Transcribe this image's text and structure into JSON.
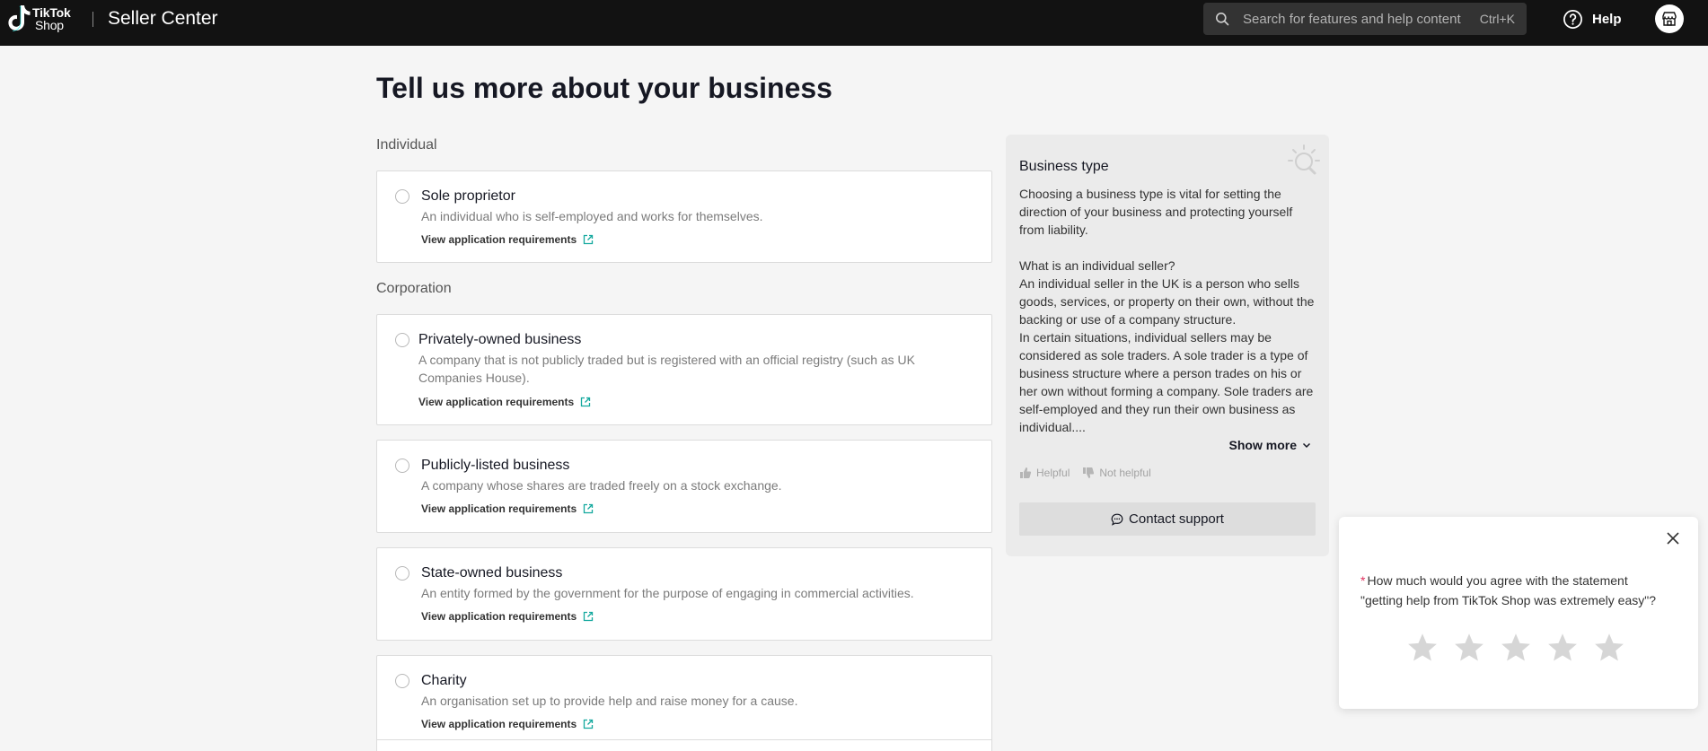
{
  "header": {
    "logo_line1": "TikTok",
    "logo_line2": "Shop",
    "app_title": "Seller Center",
    "search_placeholder": "Search for features and help content",
    "search_shortcut": "Ctrl+K",
    "help_label": "Help"
  },
  "main": {
    "page_title": "Tell us more about your business",
    "sections": [
      {
        "label": "Individual",
        "options": [
          {
            "title": "Sole proprietor",
            "desc": "An individual who is self-employed and works for themselves.",
            "link": "View application requirements"
          }
        ]
      },
      {
        "label": "Corporation",
        "options": [
          {
            "title": "Privately-owned business",
            "desc": "A company that is not publicly traded but is registered with an official registry (such as UK Companies House).",
            "link": "View application requirements"
          },
          {
            "title": "Publicly-listed business",
            "desc": "A company whose shares are traded freely on a stock exchange.",
            "link": "View application requirements"
          },
          {
            "title": "State-owned business",
            "desc": "An entity formed by the government for the purpose of engaging in commercial activities.",
            "link": "View application requirements"
          },
          {
            "title": "Charity",
            "desc": "An organisation set up to provide help and raise money for a cause.",
            "link": "View application requirements"
          }
        ]
      }
    ]
  },
  "info_panel": {
    "title": "Business type",
    "para1": "Choosing a business type is vital for setting the direction of your business and protecting yourself from liability.",
    "para2_heading": "What is an individual seller?",
    "para2": "An individual seller in the UK is a person who sells goods, services, or property on their own, without the backing or use of a company structure.",
    "para3": "In certain situations, individual sellers may be considered as sole traders. A sole trader is a type of business structure where a person trades on his or her own without forming a company. Sole traders are self-employed and they run their own business as individual....",
    "show_more": "Show more",
    "helpful": "Helpful",
    "not_helpful": "Not helpful",
    "contact_support": "Contact support"
  },
  "survey": {
    "required_mark": "*",
    "question": "How much would you agree with the statement \"getting help from TikTok Shop was extremely easy\"?",
    "star_count": 5,
    "rating": 0
  },
  "colors": {
    "topbar": "#121212",
    "accent_link_icon": "#13a89e",
    "required": "#e0315e"
  }
}
